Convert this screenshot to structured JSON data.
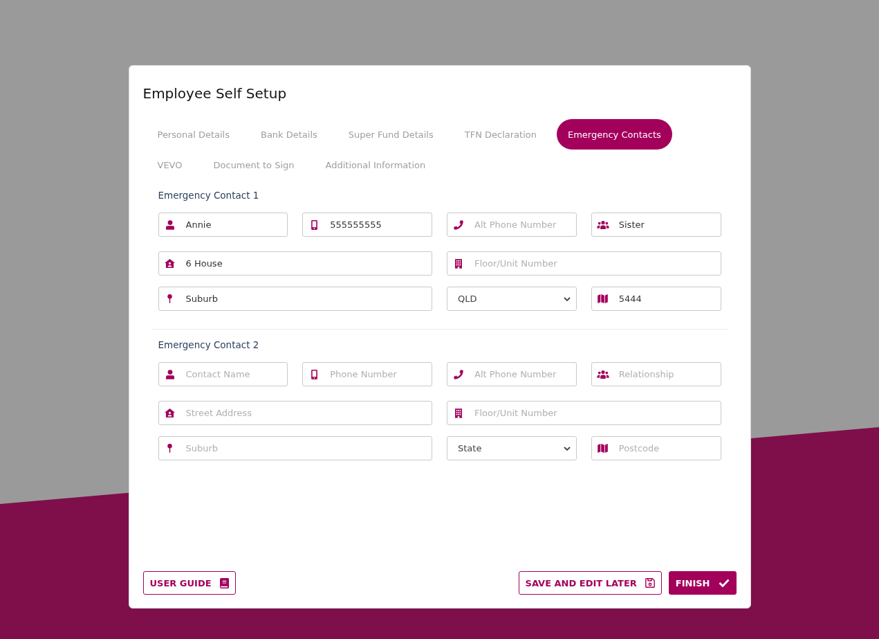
{
  "window": {
    "title": "Employee Self Setup"
  },
  "tabs": [
    {
      "label": "Personal Details",
      "selected": false
    },
    {
      "label": "Bank Details",
      "selected": false
    },
    {
      "label": "Super Fund Details",
      "selected": false
    },
    {
      "label": "TFN Declaration",
      "selected": false
    },
    {
      "label": "Emergency Contacts",
      "selected": true
    },
    {
      "label": "VEVO",
      "selected": false
    },
    {
      "label": "Document to Sign",
      "selected": false
    },
    {
      "label": "Additional Information",
      "selected": false
    }
  ],
  "sections": [
    {
      "heading": "Emergency Contact 1",
      "fields": [
        {
          "kind": "name",
          "value": "Annie"
        },
        {
          "kind": "phone",
          "value": "555555555"
        },
        {
          "kind": "alt_phone",
          "placeholder": "Alt Phone Number"
        },
        {
          "kind": "relationship",
          "value": "Sister"
        },
        {
          "kind": "street",
          "value": "6 House"
        },
        {
          "kind": "floor_unit",
          "placeholder": "Floor/Unit Number"
        },
        {
          "kind": "suburb",
          "value": "Suburb"
        },
        {
          "kind": "state",
          "value": "QLD"
        },
        {
          "kind": "postcode",
          "value": "5444"
        }
      ]
    },
    {
      "heading": "Emergency Contact 2",
      "fields": [
        {
          "kind": "name",
          "placeholder": "Contact Name"
        },
        {
          "kind": "phone",
          "placeholder": "Phone Number"
        },
        {
          "kind": "alt_phone",
          "placeholder": "Alt Phone Number"
        },
        {
          "kind": "relationship",
          "placeholder": "Relationship"
        },
        {
          "kind": "street",
          "placeholder": "Street Address"
        },
        {
          "kind": "floor_unit",
          "placeholder": "Floor/Unit Number"
        },
        {
          "kind": "suburb",
          "placeholder": "Suburb"
        },
        {
          "kind": "state",
          "value": "State"
        },
        {
          "kind": "postcode",
          "placeholder": "Postcode"
        }
      ]
    }
  ],
  "footer": {
    "left_buttons": [
      {
        "kind": "guide",
        "label": "USER GUIDE"
      }
    ],
    "right_buttons": [
      {
        "kind": "save",
        "label": "SAVE AND EDIT LATER"
      },
      {
        "kind": "finish",
        "label": "FINISH"
      }
    ]
  }
}
